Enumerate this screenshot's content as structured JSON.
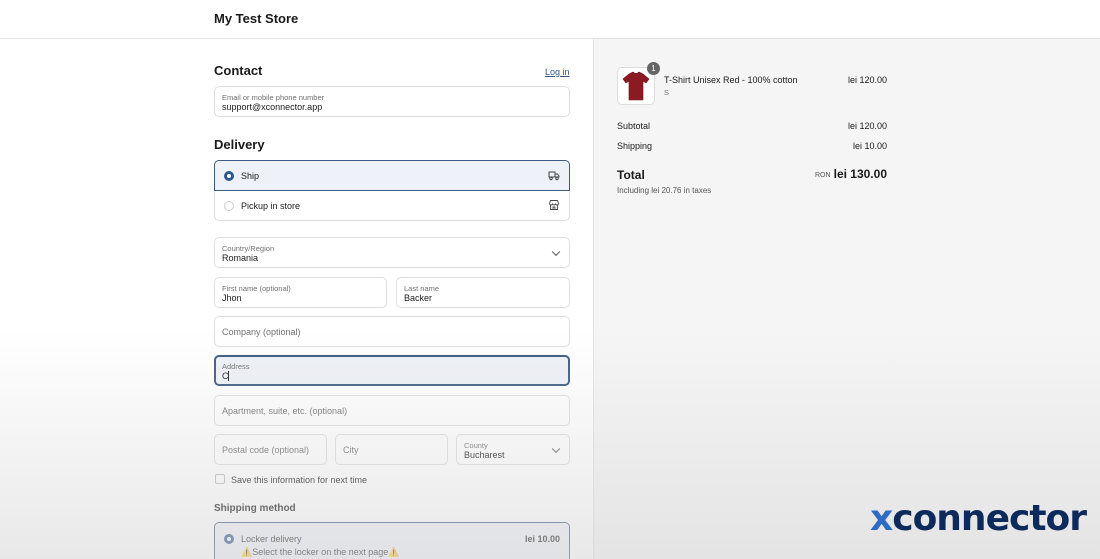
{
  "header": {
    "store_name": "My Test Store"
  },
  "contact": {
    "title": "Contact",
    "login_link": "Log in",
    "email_label": "Email or mobile phone number",
    "email_value": "support@xconnector.app"
  },
  "delivery": {
    "title": "Delivery",
    "options": [
      {
        "label": "Ship",
        "selected": true,
        "icon": "truck-icon"
      },
      {
        "label": "Pickup in store",
        "selected": false,
        "icon": "store-icon"
      }
    ],
    "country_label": "Country/Region",
    "country_value": "Romania",
    "first_name_label": "First name (optional)",
    "first_name_value": "Jhon",
    "last_name_label": "Last name",
    "last_name_value": "Backer",
    "company_placeholder": "Company (optional)",
    "address_label": "Address",
    "address_value": "C",
    "apartment_placeholder": "Apartment, suite, etc. (optional)",
    "postal_placeholder": "Postal code (optional)",
    "city_placeholder": "City",
    "county_label": "County",
    "county_value": "Bucharest",
    "save_info_label": "Save this information for next time"
  },
  "shipping_method": {
    "title": "Shipping method",
    "option_label": "Locker delivery",
    "option_price": "lei 10.00",
    "option_note": "⚠️Select the locker on the next page⚠️"
  },
  "summary": {
    "item_name": "T-Shirt Unisex Red - 100% cotton",
    "item_variant": "S",
    "item_price": "lei 120.00",
    "item_qty": "1",
    "subtotal_label": "Subtotal",
    "subtotal_value": "lei 120.00",
    "shipping_label": "Shipping",
    "shipping_value": "lei 10.00",
    "total_label": "Total",
    "currency": "RON",
    "total_value": "lei 130.00",
    "taxes_note": "Including lei 20.76 in taxes"
  },
  "branding": {
    "logo_x": "x",
    "logo_rest": "connector"
  },
  "colors": {
    "accent": "#2d5690",
    "logo_dark": "#0d2a5c",
    "logo_light": "#2e6bc4"
  }
}
